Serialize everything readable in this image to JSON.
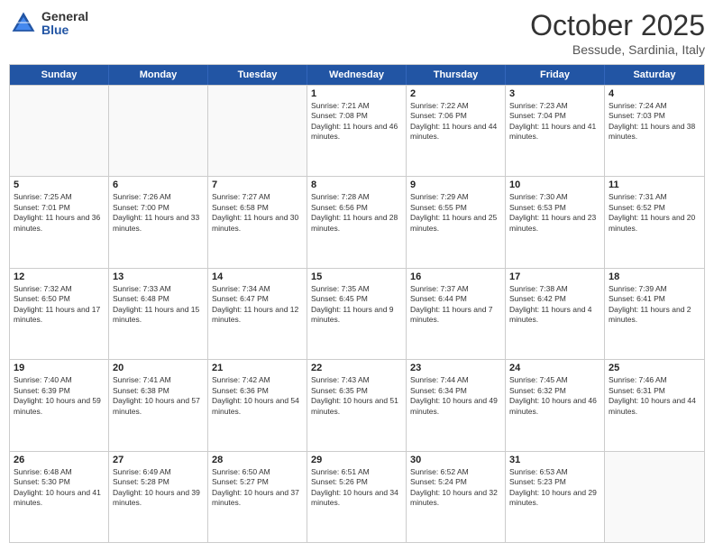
{
  "header": {
    "logo_general": "General",
    "logo_blue": "Blue",
    "month_title": "October 2025",
    "location": "Bessude, Sardinia, Italy"
  },
  "days_of_week": [
    "Sunday",
    "Monday",
    "Tuesday",
    "Wednesday",
    "Thursday",
    "Friday",
    "Saturday"
  ],
  "rows": [
    [
      {
        "day": "",
        "info": ""
      },
      {
        "day": "",
        "info": ""
      },
      {
        "day": "",
        "info": ""
      },
      {
        "day": "1",
        "info": "Sunrise: 7:21 AM\nSunset: 7:08 PM\nDaylight: 11 hours and 46 minutes."
      },
      {
        "day": "2",
        "info": "Sunrise: 7:22 AM\nSunset: 7:06 PM\nDaylight: 11 hours and 44 minutes."
      },
      {
        "day": "3",
        "info": "Sunrise: 7:23 AM\nSunset: 7:04 PM\nDaylight: 11 hours and 41 minutes."
      },
      {
        "day": "4",
        "info": "Sunrise: 7:24 AM\nSunset: 7:03 PM\nDaylight: 11 hours and 38 minutes."
      }
    ],
    [
      {
        "day": "5",
        "info": "Sunrise: 7:25 AM\nSunset: 7:01 PM\nDaylight: 11 hours and 36 minutes."
      },
      {
        "day": "6",
        "info": "Sunrise: 7:26 AM\nSunset: 7:00 PM\nDaylight: 11 hours and 33 minutes."
      },
      {
        "day": "7",
        "info": "Sunrise: 7:27 AM\nSunset: 6:58 PM\nDaylight: 11 hours and 30 minutes."
      },
      {
        "day": "8",
        "info": "Sunrise: 7:28 AM\nSunset: 6:56 PM\nDaylight: 11 hours and 28 minutes."
      },
      {
        "day": "9",
        "info": "Sunrise: 7:29 AM\nSunset: 6:55 PM\nDaylight: 11 hours and 25 minutes."
      },
      {
        "day": "10",
        "info": "Sunrise: 7:30 AM\nSunset: 6:53 PM\nDaylight: 11 hours and 23 minutes."
      },
      {
        "day": "11",
        "info": "Sunrise: 7:31 AM\nSunset: 6:52 PM\nDaylight: 11 hours and 20 minutes."
      }
    ],
    [
      {
        "day": "12",
        "info": "Sunrise: 7:32 AM\nSunset: 6:50 PM\nDaylight: 11 hours and 17 minutes."
      },
      {
        "day": "13",
        "info": "Sunrise: 7:33 AM\nSunset: 6:48 PM\nDaylight: 11 hours and 15 minutes."
      },
      {
        "day": "14",
        "info": "Sunrise: 7:34 AM\nSunset: 6:47 PM\nDaylight: 11 hours and 12 minutes."
      },
      {
        "day": "15",
        "info": "Sunrise: 7:35 AM\nSunset: 6:45 PM\nDaylight: 11 hours and 9 minutes."
      },
      {
        "day": "16",
        "info": "Sunrise: 7:37 AM\nSunset: 6:44 PM\nDaylight: 11 hours and 7 minutes."
      },
      {
        "day": "17",
        "info": "Sunrise: 7:38 AM\nSunset: 6:42 PM\nDaylight: 11 hours and 4 minutes."
      },
      {
        "day": "18",
        "info": "Sunrise: 7:39 AM\nSunset: 6:41 PM\nDaylight: 11 hours and 2 minutes."
      }
    ],
    [
      {
        "day": "19",
        "info": "Sunrise: 7:40 AM\nSunset: 6:39 PM\nDaylight: 10 hours and 59 minutes."
      },
      {
        "day": "20",
        "info": "Sunrise: 7:41 AM\nSunset: 6:38 PM\nDaylight: 10 hours and 57 minutes."
      },
      {
        "day": "21",
        "info": "Sunrise: 7:42 AM\nSunset: 6:36 PM\nDaylight: 10 hours and 54 minutes."
      },
      {
        "day": "22",
        "info": "Sunrise: 7:43 AM\nSunset: 6:35 PM\nDaylight: 10 hours and 51 minutes."
      },
      {
        "day": "23",
        "info": "Sunrise: 7:44 AM\nSunset: 6:34 PM\nDaylight: 10 hours and 49 minutes."
      },
      {
        "day": "24",
        "info": "Sunrise: 7:45 AM\nSunset: 6:32 PM\nDaylight: 10 hours and 46 minutes."
      },
      {
        "day": "25",
        "info": "Sunrise: 7:46 AM\nSunset: 6:31 PM\nDaylight: 10 hours and 44 minutes."
      }
    ],
    [
      {
        "day": "26",
        "info": "Sunrise: 6:48 AM\nSunset: 5:30 PM\nDaylight: 10 hours and 41 minutes."
      },
      {
        "day": "27",
        "info": "Sunrise: 6:49 AM\nSunset: 5:28 PM\nDaylight: 10 hours and 39 minutes."
      },
      {
        "day": "28",
        "info": "Sunrise: 6:50 AM\nSunset: 5:27 PM\nDaylight: 10 hours and 37 minutes."
      },
      {
        "day": "29",
        "info": "Sunrise: 6:51 AM\nSunset: 5:26 PM\nDaylight: 10 hours and 34 minutes."
      },
      {
        "day": "30",
        "info": "Sunrise: 6:52 AM\nSunset: 5:24 PM\nDaylight: 10 hours and 32 minutes."
      },
      {
        "day": "31",
        "info": "Sunrise: 6:53 AM\nSunset: 5:23 PM\nDaylight: 10 hours and 29 minutes."
      },
      {
        "day": "",
        "info": ""
      }
    ]
  ]
}
